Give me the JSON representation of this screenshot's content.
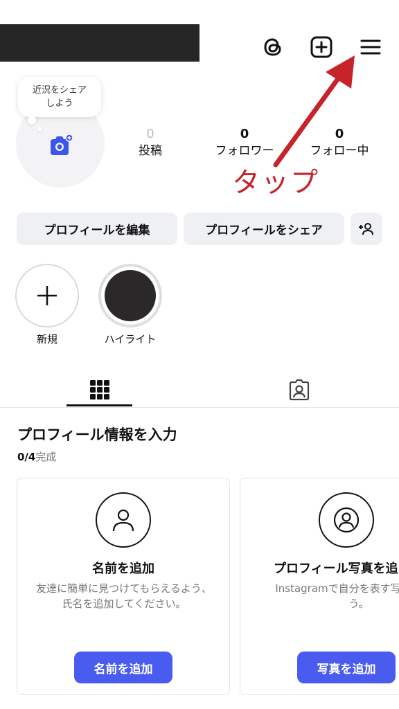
{
  "header": {
    "icons": [
      "threads-icon",
      "add-icon",
      "menu-icon"
    ]
  },
  "profile": {
    "note_bubble": "近況をシェア\nしよう",
    "stats": [
      {
        "value": "0",
        "label": "投稿"
      },
      {
        "value": "0",
        "label": "フォロワー"
      },
      {
        "value": "0",
        "label": "フォロー中"
      }
    ]
  },
  "annotation": {
    "text": "タップ",
    "color": "#c7232b"
  },
  "actions": {
    "edit_label": "プロフィールを編集",
    "share_label": "プロフィールをシェア"
  },
  "highlights": {
    "new_label": "新規",
    "item_label": "ハイライト"
  },
  "tabs": [
    "grid-icon",
    "tagged-icon"
  ],
  "profile_info": {
    "title": "プロフィール情報を入力",
    "progress_count": "0/4",
    "progress_label": "完成",
    "cards": [
      {
        "title": "名前を追加",
        "description": "友達に簡単に見つけてもらえるよう、氏名を追加してください。",
        "button": "名前を追加"
      },
      {
        "title": "プロフィール写真を追",
        "description": "Instagramで自分を表す写真を選ぼう。",
        "button": "写真を追加"
      }
    ]
  },
  "colors": {
    "accent": "#4a5cf0",
    "button_bg": "#eff0f3"
  }
}
